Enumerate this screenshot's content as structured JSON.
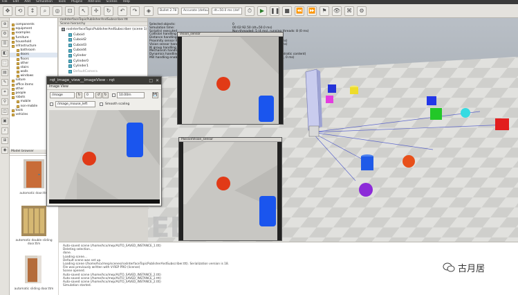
{
  "menu": [
    "File",
    "Edit",
    "Add",
    "Simulation",
    "Tools",
    "Plugins",
    "Add-ons",
    "Scenes",
    "Help"
  ],
  "toolbar": {
    "engine": "Bullet 2.78",
    "accuracy": "Accurate (default)",
    "timestep": "dt=50.0 ms (def"
  },
  "model_browser": {
    "title": "Model browser",
    "tree": [
      "components",
      "equipment",
      "examples",
      "furniture",
      "household",
      "infrastructure",
      "bathroom",
      "doors",
      "floors",
      "other",
      "stairs",
      "walls",
      "windows",
      "nature",
      "office items",
      "other",
      "people",
      "robots",
      "mobile",
      "non-mobile",
      "tools",
      "vehicles"
    ],
    "thumbnails": [
      {
        "caption": "automatic door.ttm"
      },
      {
        "caption": "automatic double sliding door.ttm"
      },
      {
        "caption": "automatic sliding door.ttm"
      }
    ]
  },
  "scene_hierarchy": {
    "title": "Scene hierarchy",
    "tab": "rosInterfaceTopicPublisherAndSubscriber.ttt",
    "items": [
      "rosInterfaceTopicPublisherAndSubscriber (scene 1)",
      "Cuboid",
      "Cuboid2",
      "Cuboid3",
      "Cuboid4",
      "Cylinder",
      "Cylinder0",
      "Cylinder1",
      "DefaultCamera"
    ]
  },
  "info": [
    {
      "k": "Selected objects:",
      "v": "0"
    },
    {
      "k": "Simulation time:",
      "v": "00:02:92.50 (dt=50.0 ms)"
    },
    {
      "k": "Script(s) executed",
      "v": "Non-threaded: 5 (4 ms), running threads: 8 (0 ms)"
    },
    {
      "k": "Collision handling enabled",
      "v": "Calculations: 0 (0 ms)"
    },
    {
      "k": "Distance handling enabled",
      "v": "Calculations: 0 (0 ms)"
    },
    {
      "k": "Proximity sensor handling enabled",
      "v": "Calculations: 0, detections: 0 (0 ms)"
    },
    {
      "k": "Vision sensor handling enabled (FBO)",
      "v": "Calculations: 1, detections: 0 (2 ms)"
    },
    {
      "k": "IK group handling enabled",
      "v": "Calculations: 0 (0 ms)"
    },
    {
      "k": "Mechanism handling enabled",
      "v": "Calculations: 0 (0 ms)"
    },
    {
      "k": "Dynamics handling enabled (Bullet 2.78)",
      "v": "Calculations passes: 0 (0 ms, quadratic content)"
    },
    {
      "k": "Mill handling enabled",
      "v": "Calculations: 0, surfaces (0 cm^2, 0 ms)"
    }
  ],
  "float_windows": {
    "top_title": "Vision_sensor",
    "bottom_title": "PassiveVision_sensor"
  },
  "watermark": "EDU",
  "rqt": {
    "title": "rqt_image_view__ImageView - rqt",
    "subtitle": "Image View",
    "topic": "/image",
    "value": "0",
    "zoom": "10.00m",
    "mouse_topic": "/image_mouse_left",
    "smooth_label": "Smooth scaling"
  },
  "console_lines": [
    "Auto-saved scene (/home/hcx/mep/AUTO_SAVED_INSTANCE_1.ttt)",
    "Deleting selection...",
    "done.",
    "Loading scene...",
    "Default scene was set up.",
    "Loading scene (/home/hcx/mep/scenes/rosInterfaceTopicPublisherAndSubscriber.ttt). Serialization version is 18.",
    "File was previously written with V-REP PRO (license)",
    "Scene opened.",
    "Auto-saved scene (/home/hcx/mep/AUTO_SAVED_INSTANCE_2.ttt)",
    "Auto-saved scene (/home/hcx/mep/AUTO_SAVED_INSTANCE_2.ttt)",
    "Auto-saved scene (/home/hcx/mep/AUTO_SAVED_INSTANCE_2.ttt)",
    "Simulation started."
  ],
  "brand": "古月居",
  "colors": {
    "red": "#e8301a",
    "blue": "#1b5cf0",
    "green": "#22c22a",
    "yellow": "#f0e030",
    "cyan": "#36d8e0",
    "magenta": "#e838e8",
    "purple": "#8a28d8"
  }
}
